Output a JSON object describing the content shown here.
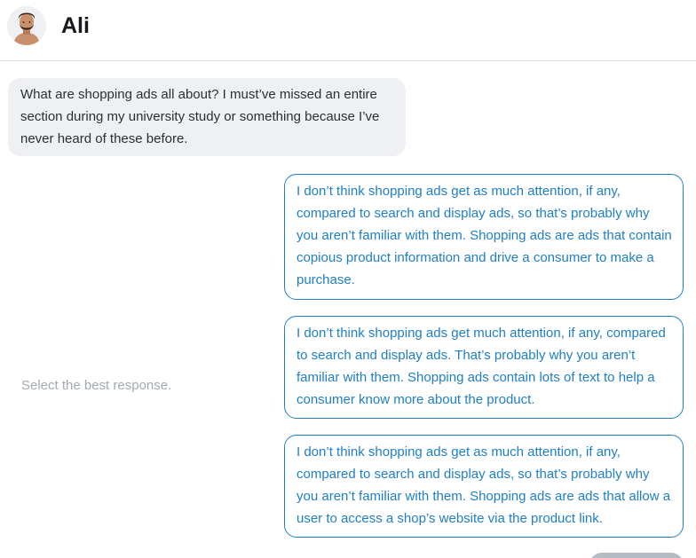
{
  "header": {
    "contact_name": "Ali"
  },
  "conversation": {
    "incoming_message": "What are shopping ads all about? I must’ve missed an entire section during my university study or something because I’ve never heard of these before."
  },
  "response_picker": {
    "prompt": "Select the best response.",
    "options": [
      {
        "text": "I don’t think shopping ads get as much attention, if any, compared to search and display ads, so that’s probably why you aren’t familiar with them. Shopping ads are ads that contain copious product information and drive a consumer to make a purchase."
      },
      {
        "text": "I don’t think shopping ads get much attention, if any, compared to search and display ads. That’s probably why you aren’t familiar with them. Shopping ads contain lots of text to help a consumer know more about the product."
      },
      {
        "text": "I don’t think shopping ads get as much attention, if any, compared to search and display ads, so that’s probably why you aren’t familiar with them. Shopping ads are ads that allow a user to access a shop’s website via the product link."
      }
    ]
  },
  "colors": {
    "accent": "#1f7fc4",
    "incoming_bubble": "#eef0f3",
    "muted_text": "#a3aab3",
    "disabled_button": "#b6bcc4"
  }
}
